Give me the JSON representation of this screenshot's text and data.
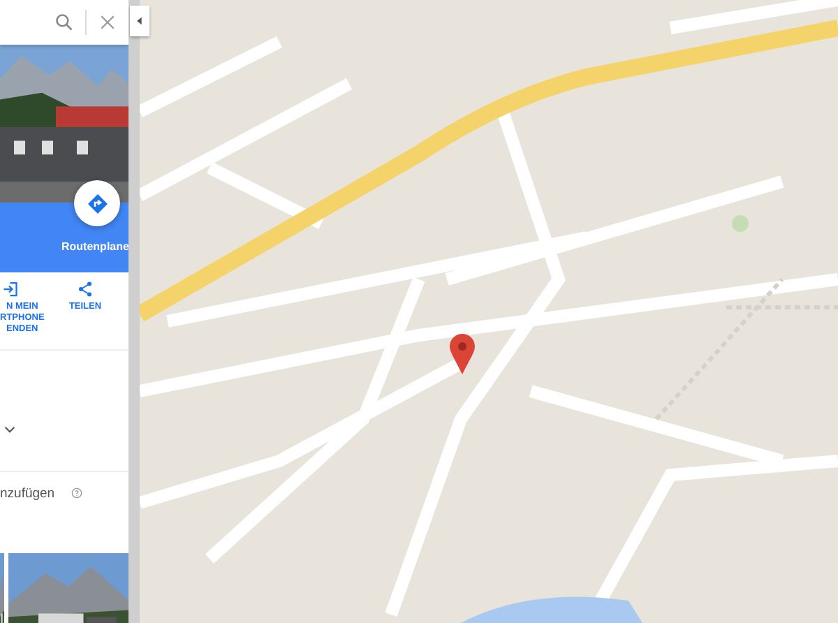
{
  "place_panel": {
    "directions_label": "Routenplane",
    "actions": [
      {
        "kind": "phone",
        "label": "N MEIN\nRTPHONE\nENDEN"
      },
      {
        "kind": "share",
        "label": "TEILEN"
      }
    ],
    "add_label": "nzufügen"
  }
}
